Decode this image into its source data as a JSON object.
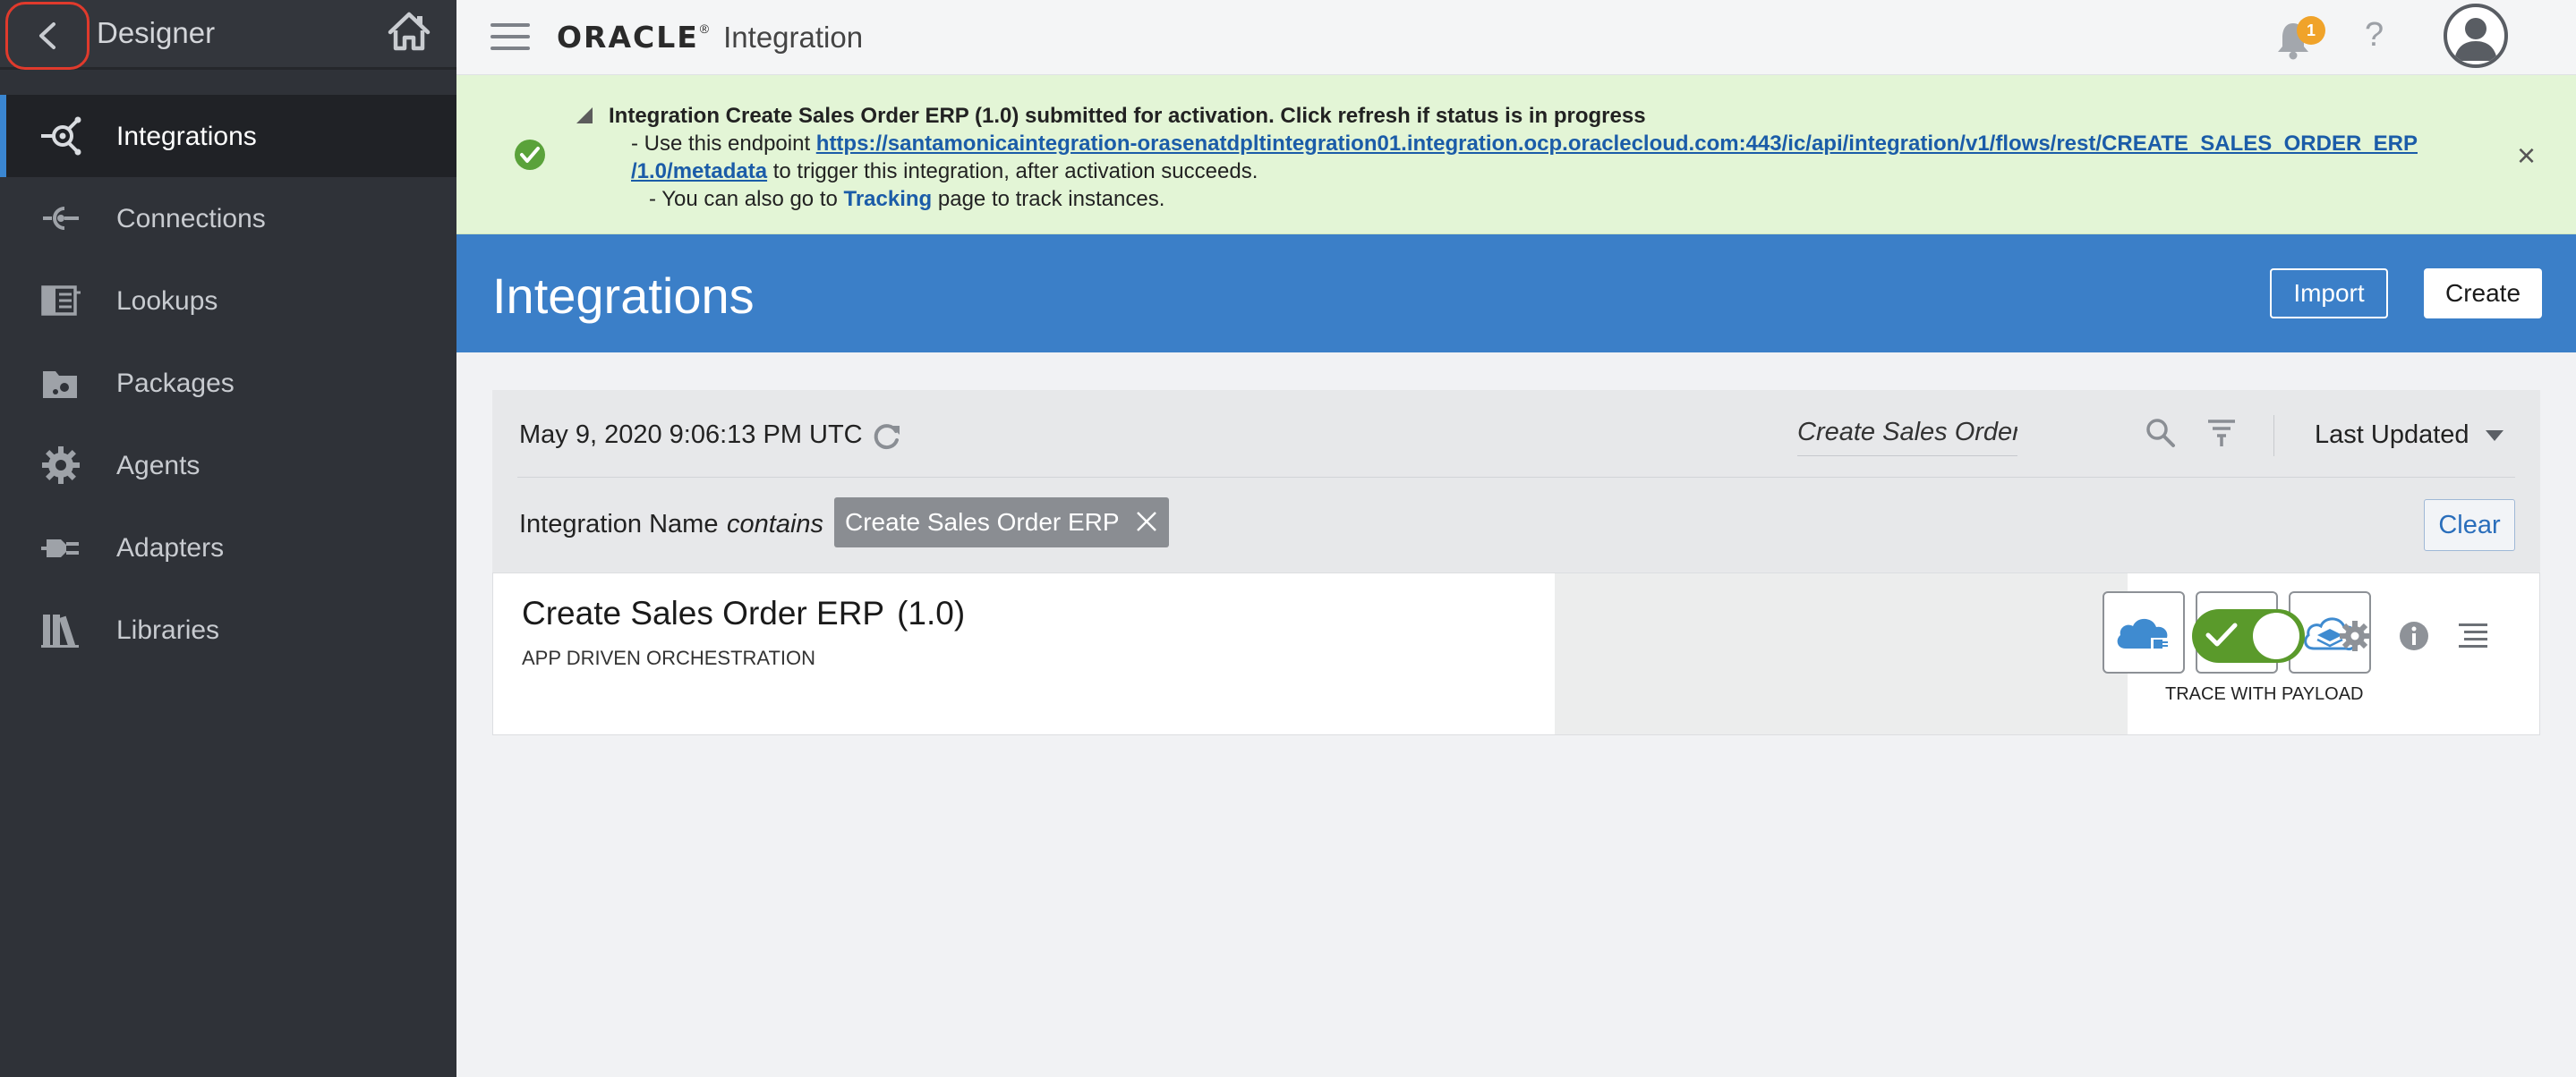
{
  "sidebar": {
    "title": "Designer",
    "items": [
      {
        "label": "Integrations",
        "icon": "integrations-icon",
        "active": true
      },
      {
        "label": "Connections",
        "icon": "connections-icon",
        "active": false
      },
      {
        "label": "Lookups",
        "icon": "lookups-icon",
        "active": false
      },
      {
        "label": "Packages",
        "icon": "packages-icon",
        "active": false
      },
      {
        "label": "Agents",
        "icon": "agents-icon",
        "active": false
      },
      {
        "label": "Adapters",
        "icon": "adapters-icon",
        "active": false
      },
      {
        "label": "Libraries",
        "icon": "libraries-icon",
        "active": false
      }
    ]
  },
  "header": {
    "brand": "ORACLE",
    "brand_reg": "®",
    "product": "Integration",
    "notification_count": "1",
    "help": "?"
  },
  "banner": {
    "title": "Integration Create Sales Order ERP (1.0) submitted for activation. Click refresh if status is in progress",
    "line2_prefix": "- Use this endpoint ",
    "endpoint_part1": "https://santamonicaintegration-orasenatdpltintegration01.integration.ocp.oraclecloud.com:443/ic/api/integration/v1/flows/rest/CREATE_SALES_ORDER_ERP",
    "endpoint_part2": "/1.0/metadata",
    "line3_suffix": " to trigger this integration, after activation succeeds.",
    "line4_prefix": "- You can also go to ",
    "tracking_link": "Tracking",
    "line4_suffix": " page to track instances.",
    "close": "×"
  },
  "page": {
    "title": "Integrations",
    "import_label": "Import",
    "create_label": "Create"
  },
  "search": {
    "timestamp": "May 9, 2020 9:06:13 PM UTC",
    "query": "Create Sales Order ERP",
    "sort_label": "Last Updated",
    "filter_field": "Integration Name",
    "filter_operator": "contains",
    "filter_value": "Create Sales Order ERP",
    "clear_label": "Clear"
  },
  "integration": {
    "name": "Create Sales Order ERP",
    "version": "(1.0)",
    "type": "APP DRIVEN ORCHESTRATION",
    "adapters": [
      "cloud-rest-adapter-icon",
      "cloud-erp-adapter-icon",
      "cloud-stack-adapter-icon"
    ],
    "active": true,
    "trace_label": "TRACE WITH PAYLOAD"
  },
  "colors": {
    "sidebar_bg": "#2f3238",
    "accent_blue": "#3b7fc8",
    "banner_bg": "#e3f5d6",
    "success_green": "#5a9a2b",
    "badge_orange": "#f0a32a",
    "back_highlight": "#e03a2c"
  }
}
